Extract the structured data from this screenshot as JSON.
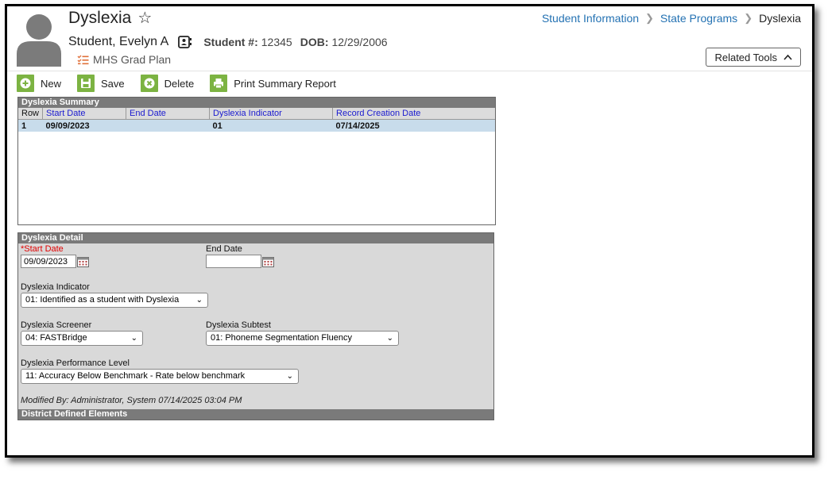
{
  "header": {
    "title": "Dyslexia",
    "student_name": "Student, Evelyn A",
    "student_num_label": "Student #:",
    "student_num": "12345",
    "dob_label": "DOB:",
    "dob": "12/29/2006",
    "grad_plan": "MHS Grad Plan",
    "related_tools": "Related Tools"
  },
  "breadcrumb": [
    "Student Information",
    "State Programs",
    "Dyslexia"
  ],
  "toolbar": {
    "new_label": "New",
    "save_label": "Save",
    "delete_label": "Delete",
    "print_label": "Print Summary Report"
  },
  "summary": {
    "title": "Dyslexia Summary",
    "columns": [
      "Row",
      "Start Date",
      "End Date",
      "Dyslexia Indicator",
      "Record Creation Date"
    ],
    "rows": [
      [
        "1",
        "09/09/2023",
        "",
        "01",
        "07/14/2025"
      ]
    ]
  },
  "detail": {
    "title": "Dyslexia Detail",
    "start_date_label": "Start Date",
    "start_date_required": "*",
    "start_date_value": "09/09/2023",
    "end_date_label": "End Date",
    "end_date_value": "",
    "indicator_label": "Dyslexia Indicator",
    "indicator_value": "01: Identified as a student with Dyslexia",
    "screener_label": "Dyslexia Screener",
    "screener_value": "04: FASTBridge",
    "subtest_label": "Dyslexia Subtest",
    "subtest_value": "01: Phoneme Segmentation Fluency",
    "performance_label": "Dyslexia Performance Level",
    "performance_value": "11: Accuracy Below Benchmark - Rate below benchmark",
    "modified_by": "Modified By: Administrator, System 07/14/2025 03:04 PM",
    "district_title": "District Defined Elements"
  },
  "colors": {
    "toolbar_green": "#7cb342",
    "link_blue": "#2472b3",
    "panel_header_gray": "#7a7a7a",
    "selected_row": "#c8dceb",
    "grad_plan_orange": "#e0703a"
  },
  "icons": {
    "favorite": "star-outline-icon",
    "student_card": "id-card-icon",
    "grad_plan": "checklist-icon",
    "related_tools": "chevron-up-icon"
  }
}
